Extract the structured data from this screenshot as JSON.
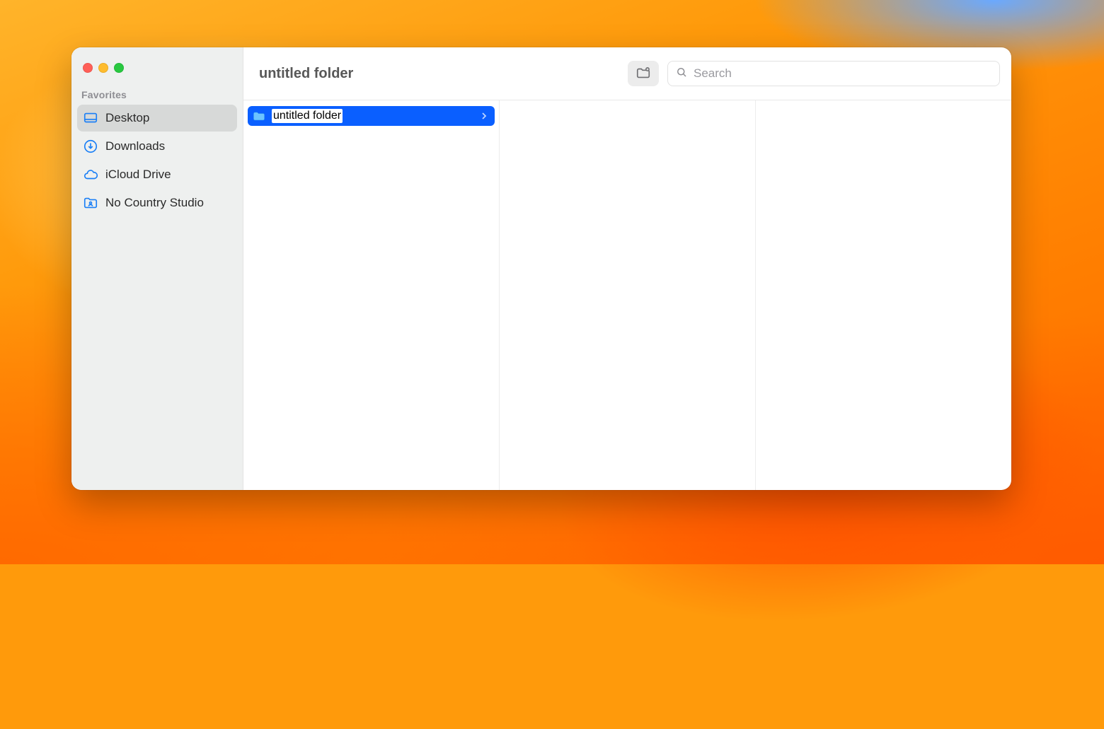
{
  "accent_color": "#0a5fff",
  "sidebar": {
    "section_title": "Favorites",
    "items": [
      {
        "id": "desktop",
        "label": "Desktop",
        "icon": "desktop-icon",
        "selected": true
      },
      {
        "id": "downloads",
        "label": "Downloads",
        "icon": "download-circle-icon",
        "selected": false
      },
      {
        "id": "icloud-drive",
        "label": "iCloud Drive",
        "icon": "cloud-icon",
        "selected": false
      },
      {
        "id": "no-country-studio",
        "label": "No Country Studio",
        "icon": "user-folder-icon",
        "selected": false
      }
    ]
  },
  "toolbar": {
    "title": "untitled folder",
    "new_folder_tooltip": "New Folder",
    "search_placeholder": "Search"
  },
  "columns": [
    {
      "items": [
        {
          "name": "untitled folder",
          "type": "folder",
          "selected": true,
          "editing": true
        }
      ]
    },
    {
      "items": []
    },
    {
      "items": []
    }
  ]
}
